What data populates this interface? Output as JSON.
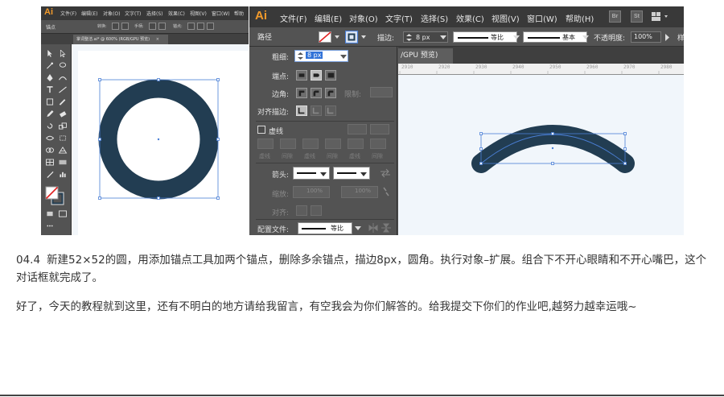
{
  "left_screenshot": {
    "app_logo": "Ai",
    "menu": [
      "文件(F)",
      "编辑(E)",
      "对象(O)",
      "文字(T)",
      "选择(S)",
      "效果(C)",
      "视图(V)",
      "窗口(W)",
      "帮助"
    ],
    "control_bar": {
      "label": "锚点",
      "tool_hints": [
        "转换:",
        "手柄:",
        "锚点:"
      ]
    },
    "document_tab": {
      "title": "掌词整洁.ai* @ 600% (RGB/GPU 预览)",
      "close": "×"
    },
    "artwork": {
      "shape": "ring",
      "color": "#223d52",
      "selection_color": "#4a7fd6"
    }
  },
  "right_screenshot": {
    "app_logo": "Ai",
    "menu": [
      "文件(F)",
      "编辑(E)",
      "对象(O)",
      "文字(T)",
      "选择(S)",
      "效果(C)",
      "视图(V)",
      "窗口(W)",
      "帮助(H)"
    ],
    "app_switchers": [
      "Br",
      "St"
    ],
    "control_bar": {
      "path_label": "路径",
      "stroke_label": "描边:",
      "stroke_value": "8 px",
      "profile_1": "等比",
      "profile_2": "基本",
      "opacity_label": "不透明度:",
      "opacity_value": "100%",
      "style_label": "样"
    },
    "stroke_panel": {
      "weight_label": "粗细:",
      "weight_value": "8 px",
      "cap_label": "端点:",
      "corner_label": "边角:",
      "limit_label": "限制:",
      "align_label": "对齐描边:",
      "dashed_label": "虚线",
      "dash_labels": [
        "虚线",
        "间隙",
        "虚线",
        "间隙",
        "虚线",
        "间隙"
      ],
      "arrow_label": "箭头:",
      "scale_label": "缩放:",
      "scale_values": [
        "100%",
        "100%"
      ],
      "align_arrow_label": "对齐:",
      "profile_label": "配置文件:",
      "profile_value": "等比"
    },
    "document_tab": {
      "title": "/GPU 预览)"
    },
    "ruler_numbers": [
      "2910",
      "2920",
      "2930",
      "2940",
      "2950",
      "2960",
      "2970",
      "2980"
    ],
    "artwork": {
      "shape": "arc",
      "color": "#223d52",
      "selection_color": "#4a7fd6"
    }
  },
  "text": {
    "step_number": "04.4",
    "step_text": "新建52×52的圆，用添加锚点工具加两个锚点，删除多余锚点，描边8px，圆角。执行对象–扩展。组合下不开心眼睛和不开心嘴巴，这个对话框就完成了。",
    "closing_text": "好了，今天的教程就到这里，还有不明白的地方请给我留言，有空我会为你们解答的。给我提交下你们的作业吧,越努力越幸运哦~"
  }
}
